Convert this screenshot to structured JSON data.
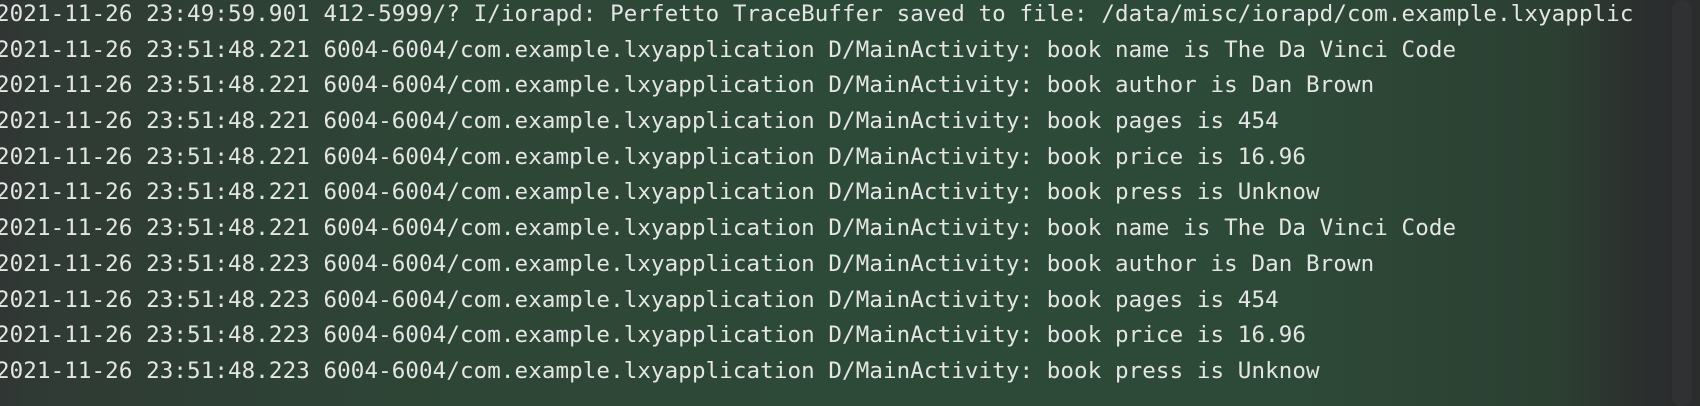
{
  "log": {
    "lines": [
      "2021-11-26 23:49:59.901 412-5999/? I/iorapd: Perfetto TraceBuffer saved to file: /data/misc/iorapd/com.example.lxyapplic",
      "2021-11-26 23:51:48.221 6004-6004/com.example.lxyapplication D/MainActivity: book name is The Da Vinci Code",
      "2021-11-26 23:51:48.221 6004-6004/com.example.lxyapplication D/MainActivity: book author is Dan Brown",
      "2021-11-26 23:51:48.221 6004-6004/com.example.lxyapplication D/MainActivity: book pages is 454",
      "2021-11-26 23:51:48.221 6004-6004/com.example.lxyapplication D/MainActivity: book price is 16.96",
      "2021-11-26 23:51:48.221 6004-6004/com.example.lxyapplication D/MainActivity: book press is Unknow",
      "2021-11-26 23:51:48.221 6004-6004/com.example.lxyapplication D/MainActivity: book name is The Da Vinci Code",
      "2021-11-26 23:51:48.223 6004-6004/com.example.lxyapplication D/MainActivity: book author is Dan Brown",
      "2021-11-26 23:51:48.223 6004-6004/com.example.lxyapplication D/MainActivity: book pages is 454",
      "2021-11-26 23:51:48.223 6004-6004/com.example.lxyapplication D/MainActivity: book price is 16.96",
      "2021-11-26 23:51:48.223 6004-6004/com.example.lxyapplication D/MainActivity: book press is Unknow"
    ]
  },
  "colors": {
    "text": "#e4e6e4",
    "background": "#2d4937"
  }
}
